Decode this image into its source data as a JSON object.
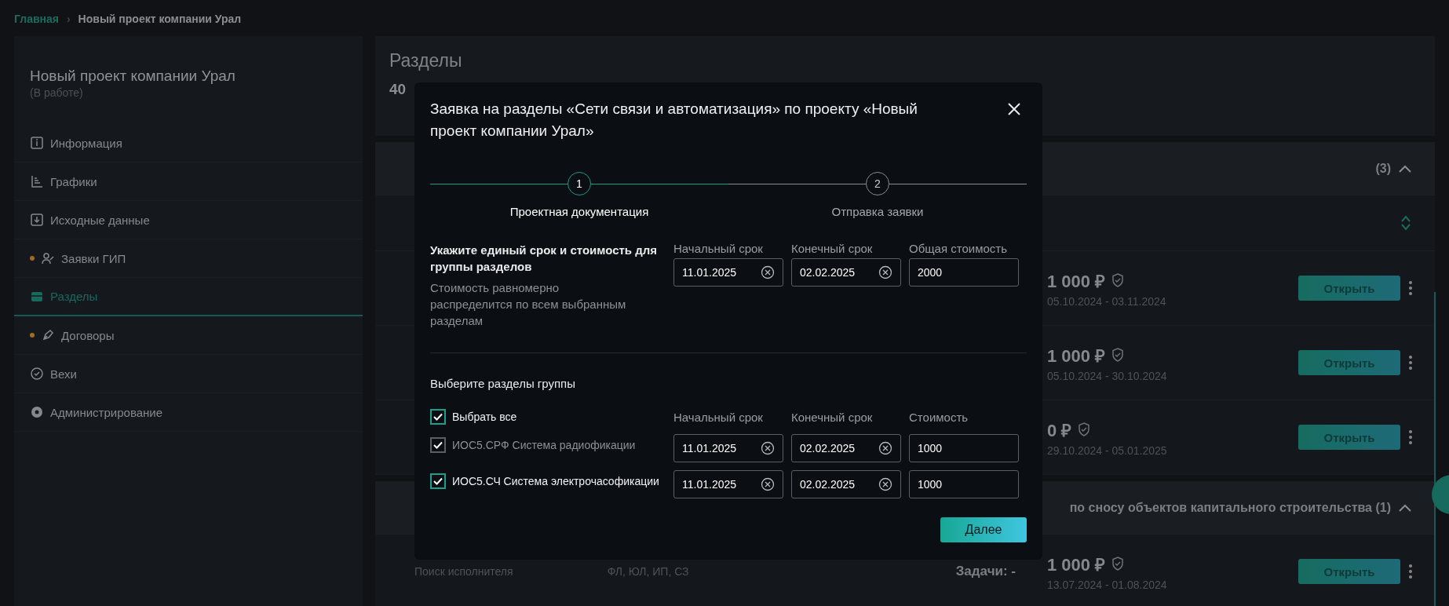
{
  "breadcrumb": [
    {
      "label": "Главная",
      "kind": "link"
    },
    {
      "label": "Новый проект компании Урал",
      "kind": "current"
    }
  ],
  "breadcrumb_separator": "›",
  "sidebar": {
    "title": "Новый проект компании Урал",
    "status": "(В работе)",
    "items": [
      {
        "label": "Информация",
        "dot": false,
        "selected": false
      },
      {
        "label": "Графики",
        "dot": false,
        "selected": false
      },
      {
        "label": "Исходные данные",
        "dot": false,
        "selected": false
      },
      {
        "label": "Заявки ГИП",
        "dot": true,
        "selected": false
      },
      {
        "label": "Разделы",
        "dot": false,
        "selected": true
      },
      {
        "label": "Договоры",
        "dot": true,
        "selected": false
      },
      {
        "label": "Вехи",
        "dot": false,
        "selected": false
      },
      {
        "label": "Администрирование",
        "dot": false,
        "selected": false
      }
    ]
  },
  "main": {
    "heading": "Разделы",
    "count": "40",
    "groups": [
      {
        "title": "(3)",
        "rows": [
          {
            "price": "1 000 ₽",
            "dates": "05.10.2024 - 03.11.2024",
            "button": "Открыть"
          },
          {
            "price": "1 000 ₽",
            "dates": "05.10.2024 - 30.10.2024",
            "button": "Открыть"
          },
          {
            "price": "0 ₽",
            "dates": "29.10.2024 - 05.01.2025",
            "button": "Открыть"
          }
        ]
      },
      {
        "title": "по сносу объектов капитального строительства (1)",
        "rows": [
          {
            "status": "Поиск исполнителя",
            "form": "ФЛ, ЮЛ, ИП, СЗ",
            "tasks": "Задачи: -",
            "price": "1 000 ₽",
            "dates": "13.07.2024 - 01.08.2024",
            "button": "Открыть"
          }
        ]
      }
    ]
  },
  "dialog": {
    "title": "Заявка на разделы «Сети связи и автоматизация» по проекту «Новый проект компании Урал»",
    "steps": [
      {
        "number": "1",
        "label": "Проектная документация",
        "selected": true
      },
      {
        "number": "2",
        "label": "Отправка заявки",
        "selected": false
      }
    ],
    "group_form": {
      "heading": "Укажите единый срок и стоимость для группы разделов",
      "hint": "Стоимость равномерно распределится по всем выбранным разделам",
      "fields": [
        {
          "label": "Начальный срок",
          "value": "11.01.2025",
          "kind": "date"
        },
        {
          "label": "Конечный срок",
          "value": "02.02.2025",
          "kind": "date"
        },
        {
          "label": "Общая стоимость",
          "value": "2000",
          "kind": "text"
        }
      ]
    },
    "sections": {
      "heading": "Выберите разделы группы",
      "select_all": {
        "label": "Выбрать все",
        "checked": true
      },
      "columns": [
        "Начальный срок",
        "Конечный срок",
        "Стоимость"
      ],
      "rows": [
        {
          "label": "ИОС5.СРФ Система радиофикации",
          "checked": true,
          "disabled": true,
          "start": "11.01.2025",
          "end": "02.02.2025",
          "cost": "1000"
        },
        {
          "label": "ИОС5.СЧ Система электрочасофикации",
          "checked": true,
          "disabled": false,
          "start": "11.01.2025",
          "end": "02.02.2025",
          "cost": "1000"
        }
      ]
    },
    "next_button": "Далее"
  }
}
